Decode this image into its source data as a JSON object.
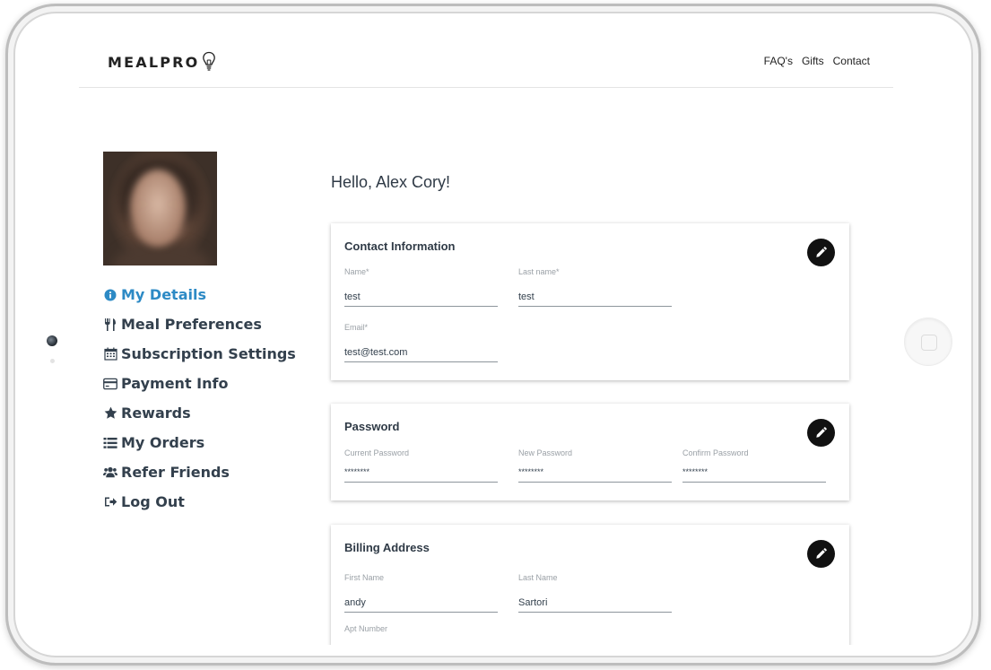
{
  "header": {
    "logo_text": "MEALPRO",
    "nav": [
      "FAQ's",
      "Gifts",
      "Contact"
    ]
  },
  "sidebar": {
    "items": [
      {
        "label": "My Details",
        "icon": "info-circle-icon",
        "active": true
      },
      {
        "label": "Meal Preferences",
        "icon": "utensils-icon",
        "active": false
      },
      {
        "label": "Subscription Settings",
        "icon": "calendar-icon",
        "active": false
      },
      {
        "label": "Payment Info",
        "icon": "credit-card-icon",
        "active": false
      },
      {
        "label": "Rewards",
        "icon": "star-icon",
        "active": false
      },
      {
        "label": "My Orders",
        "icon": "list-icon",
        "active": false
      },
      {
        "label": "Refer Friends",
        "icon": "users-icon",
        "active": false
      },
      {
        "label": "Log Out",
        "icon": "sign-out-icon",
        "active": false
      }
    ]
  },
  "main": {
    "greeting": "Hello, Alex Cory!",
    "contact": {
      "title": "Contact Information",
      "name_label": "Name*",
      "name_value": "test",
      "lastname_label": "Last name*",
      "lastname_value": "test",
      "email_label": "Email*",
      "email_value": "test@test.com"
    },
    "password": {
      "title": "Password",
      "current_label": "Current Password",
      "current_value": "********",
      "new_label": "New Password",
      "new_value": "********",
      "confirm_label": "Confirm Password",
      "confirm_value": "********"
    },
    "billing": {
      "title": "Billing Address",
      "first_label": "First Name",
      "first_value": "andy",
      "last_label": "Last Name",
      "last_value": "Sartori",
      "apt_label": "Apt Number"
    }
  },
  "colors": {
    "accent": "#2d8ac5",
    "text": "#33404d",
    "edit_button": "#111111"
  }
}
